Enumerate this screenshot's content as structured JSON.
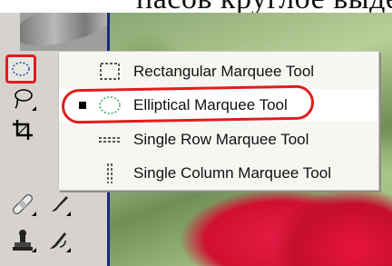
{
  "caption": {
    "text": "пасов круглое выделение."
  },
  "menu": {
    "items": [
      {
        "label": "Rectangular Marquee Tool"
      },
      {
        "label": "Elliptical Marquee Tool",
        "selected": true
      },
      {
        "label": "Single Row Marquee Tool"
      },
      {
        "label": "Single Column Marquee Tool"
      }
    ]
  },
  "toolbox": {
    "tools": [
      {
        "icon": "elliptical-marquee-icon",
        "active": true
      },
      {
        "icon": "lasso-icon"
      },
      {
        "icon": "crop-icon"
      },
      {
        "icon": "healing-brush-icon"
      },
      {
        "icon": "brush-icon"
      },
      {
        "icon": "clone-stamp-icon"
      },
      {
        "icon": "history-brush-icon"
      }
    ]
  },
  "colors": {
    "highlight": "#e11d1d",
    "menu_bg": "#f7f6f3",
    "toolbox_bg": "#d6d3ce"
  }
}
